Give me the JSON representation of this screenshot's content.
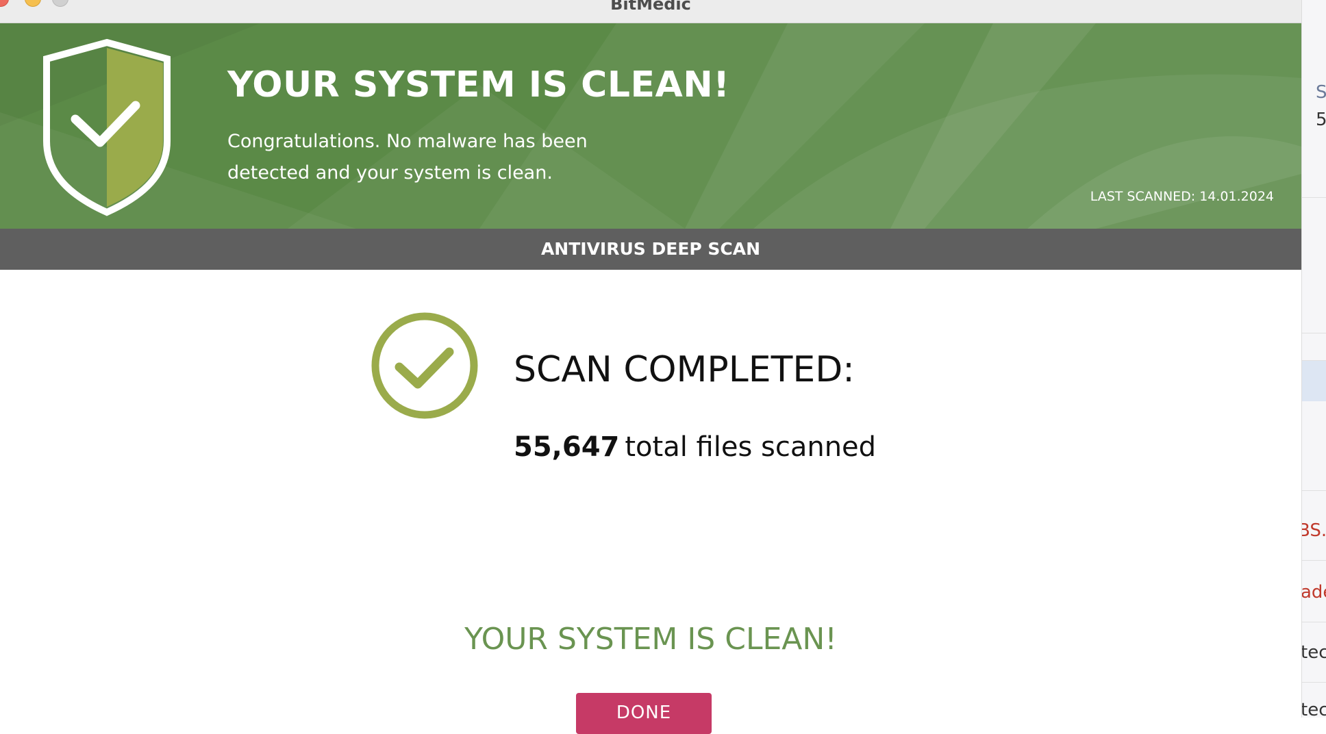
{
  "window": {
    "title": "BitMedic"
  },
  "banner": {
    "title": "YOUR SYSTEM IS CLEAN!",
    "subtitle": "Congratulations. No malware has been detected and your system is clean.",
    "last_scanned_label": "LAST SCANNED:",
    "last_scanned_date": "14.01.2024"
  },
  "section": {
    "title": "ANTIVIRUS DEEP SCAN"
  },
  "scan": {
    "status_title": "SCAN COMPLETED:",
    "files_count": "55,647",
    "files_label": "total files scanned"
  },
  "result": {
    "message": "YOUR SYSTEM IS CLEAN!"
  },
  "actions": {
    "done_label": "DONE"
  },
  "background_window": {
    "fragments": [
      "S",
      "5",
      "BS./",
      "ade",
      "tec",
      "tec"
    ]
  },
  "colors": {
    "banner_green": "#5b8a47",
    "accent_olive": "#9aab4b",
    "clean_green": "#6a9451",
    "section_gray": "#5f5f5f",
    "done_button": "#c63a66"
  }
}
